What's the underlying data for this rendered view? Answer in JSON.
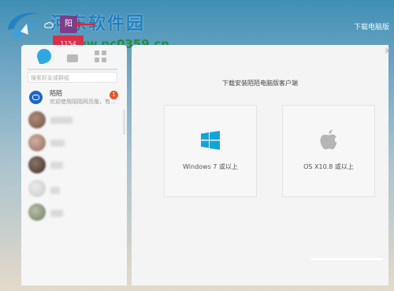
{
  "watermark": {
    "site_name": "河东软件园",
    "url": "www.pc0359.cn"
  },
  "topbar": {
    "avatar_text": "阳",
    "badge_text": "1154",
    "download_link": "下载电脑版"
  },
  "sidebar": {
    "search_placeholder": "搜索好友或群组",
    "conversations": [
      {
        "name": "陌陌",
        "preview": "欢迎使用陌陌网页版，有...",
        "badge": "1"
      }
    ]
  },
  "main": {
    "title": "下载安装陌陌电脑版客户端",
    "corner_text": "关",
    "windows": {
      "label": "Windows 7 或以上",
      "icon": "windows-icon",
      "color": "#14a3d9"
    },
    "mac": {
      "label": "OS X10.8 或以上",
      "icon": "apple-icon",
      "color": "#b5b5b5"
    }
  },
  "colors": {
    "accent": "#2ea8e2",
    "badge": "#e8572a"
  }
}
